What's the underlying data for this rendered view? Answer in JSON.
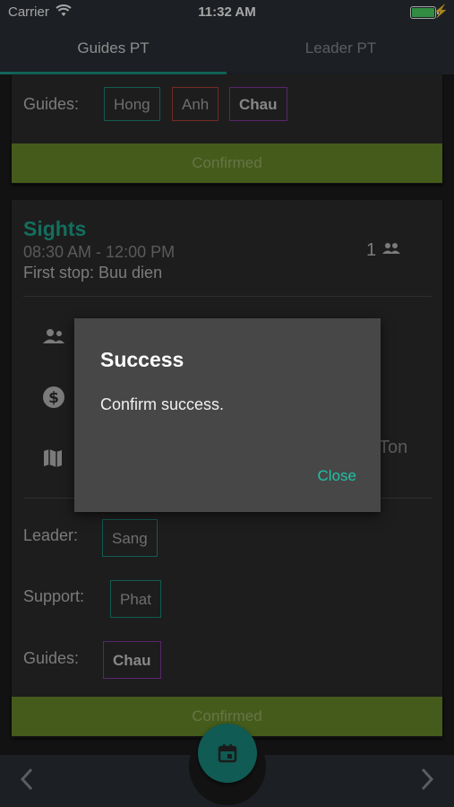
{
  "status_bar": {
    "carrier": "Carrier",
    "time": "11:32 AM"
  },
  "tabs": [
    {
      "label": "Guides PT",
      "active": true
    },
    {
      "label": "Leader PT",
      "active": false
    }
  ],
  "top_card": {
    "guides_label": "Guides:",
    "guides": [
      "Hong",
      "Anh",
      "Chau"
    ],
    "confirm_label": "Confirmed"
  },
  "sight_card": {
    "title": "Sights",
    "time": "08:30 AM - 12:00 PM",
    "first_stop": "First stop: Buu dien",
    "count": "1",
    "partial_address": "Ton",
    "leader_label": "Leader:",
    "leader": "Sang",
    "support_label": "Support:",
    "support": "Phat",
    "guides_label": "Guides:",
    "guides": [
      "Chau"
    ],
    "confirm_label": "Confirmed"
  },
  "dialog": {
    "title": "Success",
    "message": "Confirm success.",
    "close_label": "Close"
  },
  "bottom_nav": {
    "prev_icon": "chevron-left-icon",
    "next_icon": "chevron-right-icon",
    "fab_icon": "calendar-icon"
  },
  "colors": {
    "accent": "#1e9b8a",
    "confirm": "#6a8c2a",
    "dialog_link": "#1ec2a7"
  }
}
